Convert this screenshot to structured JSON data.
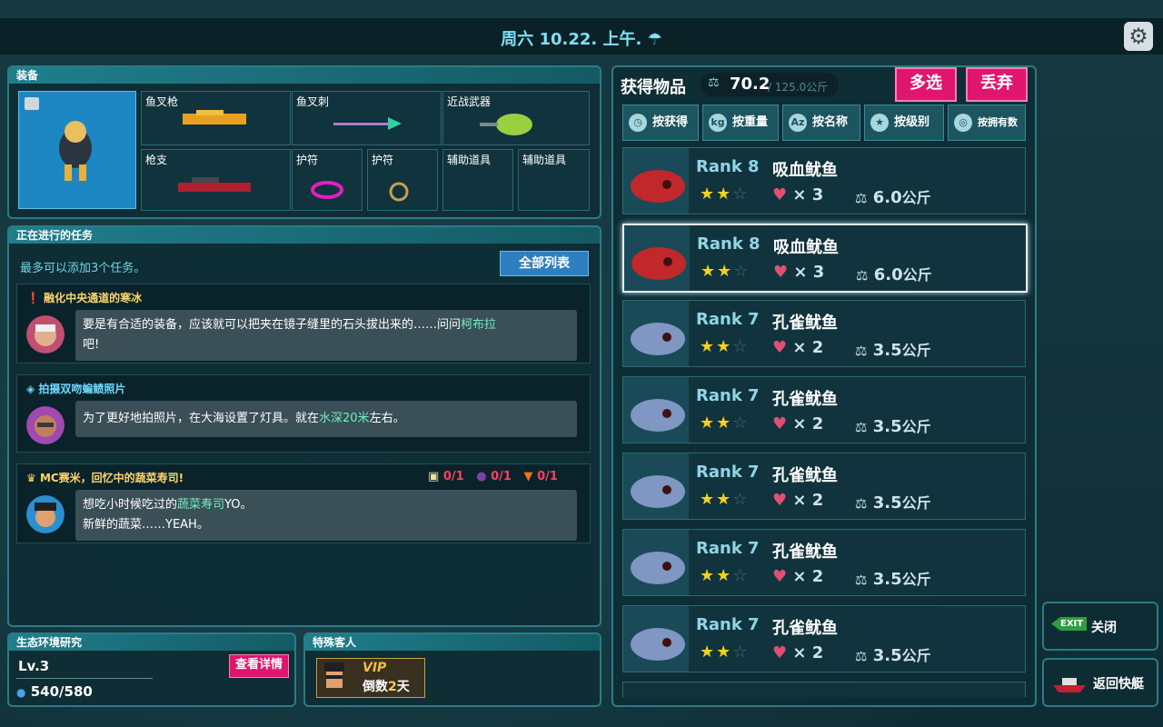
{
  "header": {
    "date": "周六 10.22. 上午.",
    "weather_icon": "rain-cloud-icon"
  },
  "equipment": {
    "title": "装备",
    "slots": [
      {
        "label": "鱼叉枪"
      },
      {
        "label": "鱼叉刺"
      },
      {
        "label": "近战武器"
      },
      {
        "label": "枪支"
      },
      {
        "label": "护符"
      },
      {
        "label": "护符"
      },
      {
        "label": "辅助道具"
      },
      {
        "label": "辅助道具"
      }
    ]
  },
  "quests": {
    "title": "正在进行的任务",
    "hint": "最多可以添加3个任务。",
    "list_button": "全部列表",
    "items": [
      {
        "title": "融化中央通道的寒冰",
        "text_a": "要是有合适的装备，应该就可以把夹在镜子缝里的石头拔出来的……问问",
        "highlight": "柯布拉",
        "text_b": "吧!"
      },
      {
        "title": "拍摄双吻蝙鲼照片",
        "text_a": "为了更好地拍照片，在大海设置了灯具。就在",
        "highlight": "水深20米",
        "text_b": "左右。"
      },
      {
        "title": "MC赛米，回忆中的蔬菜寿司!",
        "text_a": "想吃小时候吃过的",
        "highlight": "蔬菜寿司",
        "text_b": "YO。",
        "line2": "新鲜的蔬菜……YEAH。",
        "requirements": [
          "0/1",
          "0/1",
          "0/1"
        ]
      }
    ]
  },
  "eco": {
    "title": "生态环境研究",
    "level": "Lv.3",
    "button": "查看详情",
    "points": "540/580"
  },
  "special": {
    "title": "特殊客人",
    "vip": "VIP",
    "countdown_prefix": "倒数",
    "countdown_num": "2",
    "countdown_suffix": "天"
  },
  "inventory": {
    "title": "获得物品",
    "weight": "70.2",
    "capacity": "/ 125.0公斤",
    "multi_select": "多选",
    "discard": "丢弃",
    "sort_tabs": [
      "按获得",
      "按重量",
      "按名称",
      "按级别",
      "按拥有数"
    ],
    "items": [
      {
        "rank": "Rank 8",
        "name": "吸血鱿鱼",
        "qty": "× 3",
        "weight": "6.0",
        "unit": "公斤",
        "stars": 2,
        "color": "#c0282c"
      },
      {
        "rank": "Rank 8",
        "name": "吸血鱿鱼",
        "qty": "× 3",
        "weight": "6.0",
        "unit": "公斤",
        "stars": 2,
        "color": "#c0282c"
      },
      {
        "rank": "Rank 7",
        "name": "孔雀鱿鱼",
        "qty": "× 2",
        "weight": "3.5",
        "unit": "公斤",
        "stars": 2,
        "color": "#7f97c2"
      },
      {
        "rank": "Rank 7",
        "name": "孔雀鱿鱼",
        "qty": "× 2",
        "weight": "3.5",
        "unit": "公斤",
        "stars": 2,
        "color": "#7f97c2"
      },
      {
        "rank": "Rank 7",
        "name": "孔雀鱿鱼",
        "qty": "× 2",
        "weight": "3.5",
        "unit": "公斤",
        "stars": 2,
        "color": "#7f97c2"
      },
      {
        "rank": "Rank 7",
        "name": "孔雀鱿鱼",
        "qty": "× 2",
        "weight": "3.5",
        "unit": "公斤",
        "stars": 2,
        "color": "#7f97c2"
      },
      {
        "rank": "Rank 7",
        "name": "孔雀鱿鱼",
        "qty": "× 2",
        "weight": "3.5",
        "unit": "公斤",
        "stars": 2,
        "color": "#7f97c2"
      }
    ]
  },
  "side": {
    "exit_badge": "EXIT",
    "close": "关闭",
    "return": "返回快艇"
  }
}
